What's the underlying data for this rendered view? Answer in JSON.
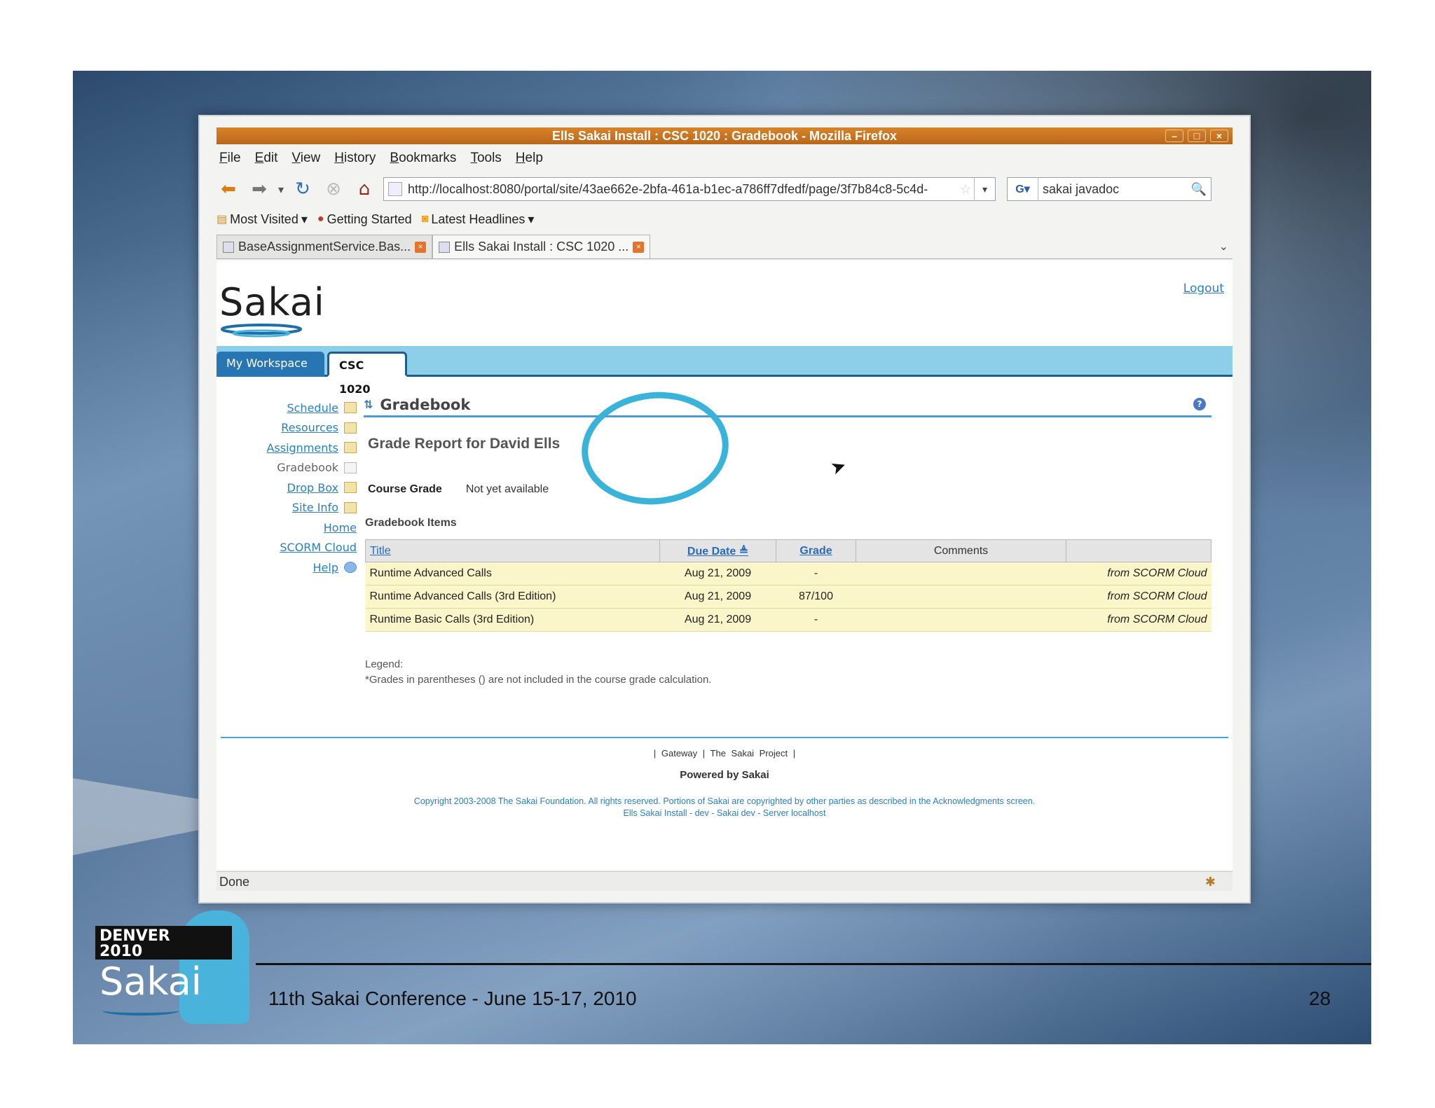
{
  "browser": {
    "window_title": "Ells Sakai Install : CSC 1020 : Gradebook - Mozilla Firefox",
    "menu": [
      "File",
      "Edit",
      "View",
      "History",
      "Bookmarks",
      "Tools",
      "Help"
    ],
    "url": "http://localhost:8080/portal/site/43ae662e-2bfa-461a-b1ec-a786ff7dfedf/page/3f7b84c8-5c4d-",
    "search_value": "sakai javadoc",
    "bookmarks": [
      "Most Visited",
      "Getting Started",
      "Latest Headlines"
    ],
    "tabs": [
      "BaseAssignmentService.Bas...",
      "Ells Sakai Install : CSC 1020 ..."
    ],
    "status": "Done"
  },
  "sakai": {
    "logo_text": "Sakai",
    "logout": "Logout",
    "site_tabs": [
      "My Workspace",
      "CSC 1020"
    ],
    "tools": [
      "Schedule",
      "Resources",
      "Assignments",
      "Gradebook",
      "Drop Box",
      "Site Info",
      "Home",
      "SCORM Cloud",
      "Help"
    ],
    "tool_title": "Gradebook",
    "report_title": "Grade Report for David Ells",
    "course_grade_label": "Course Grade",
    "course_grade_value": "Not yet available",
    "items_heading": "Gradebook Items",
    "table": {
      "headers": [
        "Title",
        "Due Date",
        "Grade",
        "Comments",
        ""
      ],
      "rows": [
        {
          "title": "Runtime Advanced Calls",
          "due": "Aug 21, 2009",
          "grade": "-",
          "comments": "",
          "source": "from SCORM Cloud"
        },
        {
          "title": "Runtime Advanced Calls (3rd Edition)",
          "due": "Aug 21, 2009",
          "grade": "87/100",
          "comments": "",
          "source": "from SCORM Cloud"
        },
        {
          "title": "Runtime Basic Calls (3rd Edition)",
          "due": "Aug 21, 2009",
          "grade": "-",
          "comments": "",
          "source": "from SCORM Cloud"
        }
      ]
    },
    "legend_title": "Legend:",
    "legend_text": "*Grades in parentheses () are not included in the course grade calculation.",
    "footer_links": "|   Gateway   |   The Sakai Project   |",
    "powered_by": "Powered by Sakai",
    "copyright_line1": "Copyright 2003-2008 The Sakai Foundation. All rights reserved. Portions of Sakai are copyrighted by other parties as described in the Acknowledgments screen.",
    "copyright_line2": "Ells Sakai Install - dev - Sakai dev - Server localhost"
  },
  "slide": {
    "logo_event": "DENVER",
    "logo_year": "2010",
    "logo_brand": "Sakai",
    "conference": "11th Sakai Conference - June 15-17, 2010",
    "page_number": "28"
  },
  "colors": {
    "sakai_blue": "#2a7fc1",
    "site_nav_bg": "#8dcfe8",
    "highlight_circle": "#39b3d9",
    "row_bg": "#fbf6c9"
  }
}
